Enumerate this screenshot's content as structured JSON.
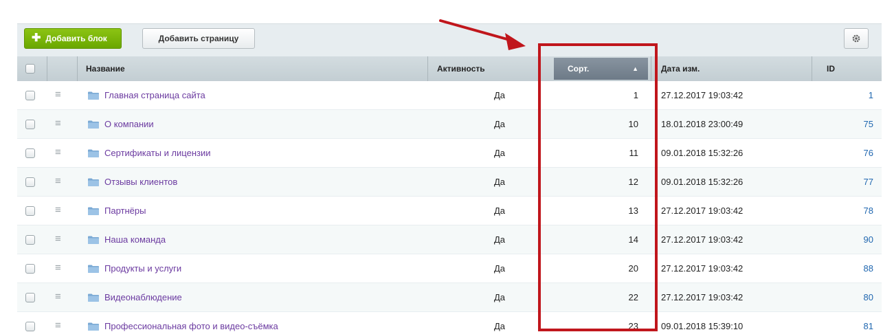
{
  "toolbar": {
    "add_block_label": "Добавить блок",
    "add_page_label": "Добавить страницу",
    "settings_icon": "gear-icon"
  },
  "table": {
    "columns": {
      "name": "Название",
      "active": "Активность",
      "sort": "Сорт.",
      "date": "Дата изм.",
      "id": "ID"
    },
    "sort_direction_icon": "sort-ascending-icon",
    "rows": [
      {
        "name": "Главная страница сайта",
        "active": "Да",
        "sort": "1",
        "date": "27.12.2017 19:03:42",
        "id": "1"
      },
      {
        "name": "О компании",
        "active": "Да",
        "sort": "10",
        "date": "18.01.2018 23:00:49",
        "id": "75"
      },
      {
        "name": "Сертификаты и лицензии",
        "active": "Да",
        "sort": "11",
        "date": "09.01.2018 15:32:26",
        "id": "76"
      },
      {
        "name": "Отзывы клиентов",
        "active": "Да",
        "sort": "12",
        "date": "09.01.2018 15:32:26",
        "id": "77"
      },
      {
        "name": "Партнёры",
        "active": "Да",
        "sort": "13",
        "date": "27.12.2017 19:03:42",
        "id": "78"
      },
      {
        "name": "Наша команда",
        "active": "Да",
        "sort": "14",
        "date": "27.12.2017 19:03:42",
        "id": "90"
      },
      {
        "name": "Продукты и услуги",
        "active": "Да",
        "sort": "20",
        "date": "27.12.2017 19:03:42",
        "id": "88"
      },
      {
        "name": "Видеонаблюдение",
        "active": "Да",
        "sort": "22",
        "date": "27.12.2017 19:03:42",
        "id": "80"
      },
      {
        "name": "Профессиональная фото и видео-съёмка",
        "active": "Да",
        "sort": "23",
        "date": "09.01.2018 15:39:10",
        "id": "81"
      }
    ]
  },
  "colors": {
    "accent_green": "#6aa700",
    "link_purple": "#6b3aa0",
    "id_blue": "#2067b0",
    "annotation_red": "#c0161c"
  }
}
